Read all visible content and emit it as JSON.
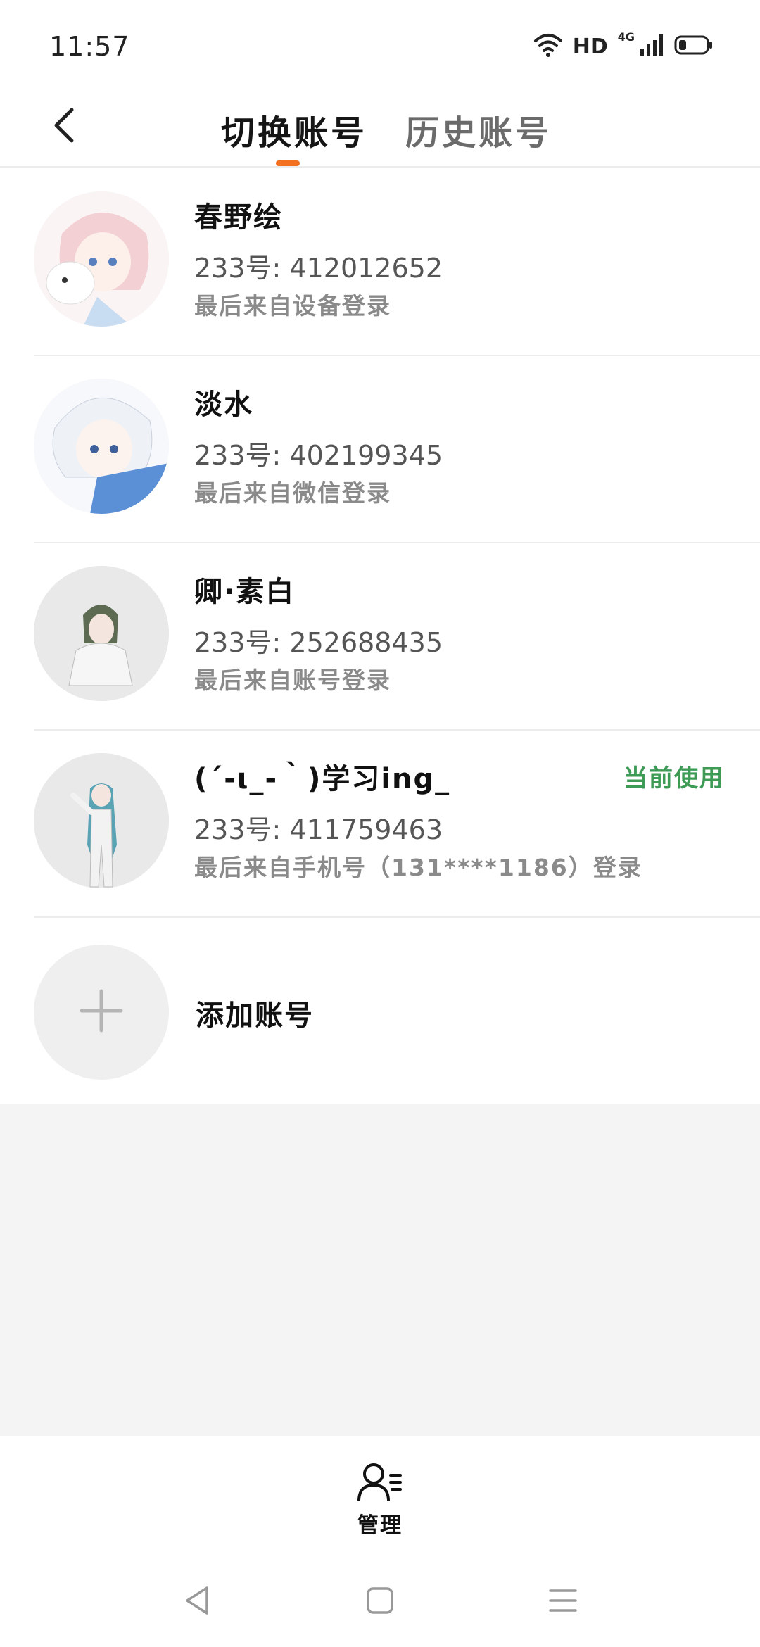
{
  "status_bar": {
    "time": "11:57",
    "hd": "HD",
    "network": "4G",
    "icons": [
      "wifi-icon",
      "signal-icon",
      "battery-icon"
    ]
  },
  "header": {
    "tabs": [
      {
        "label": "切换账号",
        "active": true
      },
      {
        "label": "历史账号",
        "active": false
      }
    ],
    "accent_color": "#f37021"
  },
  "accounts": [
    {
      "name": "春野绘",
      "id": "233号: 412012652",
      "login": "最后来自设备登录",
      "current": ""
    },
    {
      "name": "淡水",
      "id": "233号: 402199345",
      "login": "最后来自微信登录",
      "current": ""
    },
    {
      "name": "卿·素白",
      "id": "233号: 252688435",
      "login": "最后来自账号登录",
      "current": ""
    },
    {
      "name": "(´-ι_-｀)学习ing_",
      "id": "233号: 411759463",
      "login": "最后来自手机号（131****1186）登录",
      "current": "当前使用"
    }
  ],
  "add_account": {
    "label": "添加账号"
  },
  "bottom_bar": {
    "manage_label": "管理"
  },
  "colors": {
    "current_green": "#3d9b56",
    "divider": "#ececec",
    "grey_bg": "#f4f4f4"
  }
}
